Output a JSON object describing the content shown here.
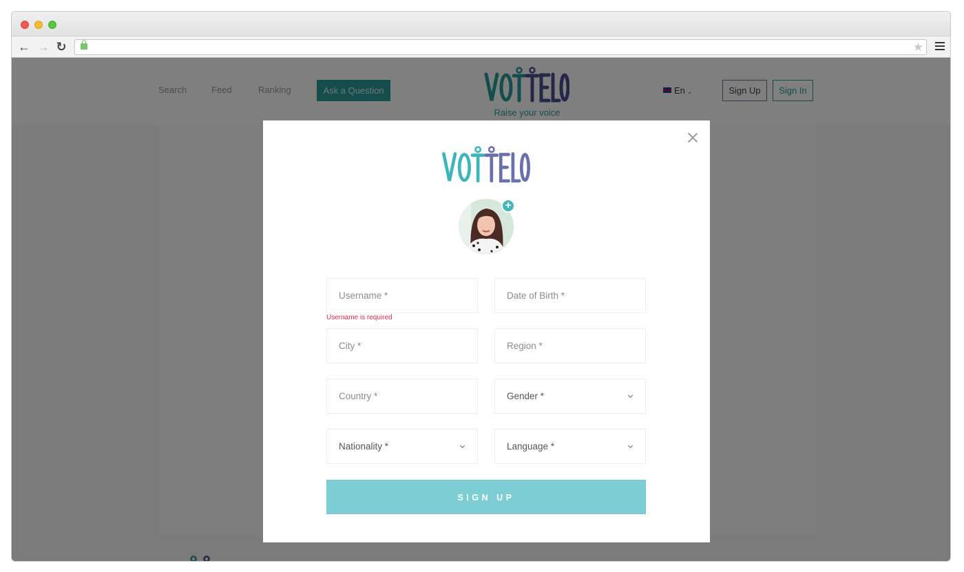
{
  "browser": {
    "url": "",
    "secure": true
  },
  "site": {
    "nav": [
      "Search",
      "Feed",
      "Ranking"
    ],
    "ask_button": "Ask a Question",
    "brand": "VOTTELO",
    "tagline": "Raise your voice",
    "language": "En",
    "sign_up": "Sign Up",
    "sign_in": "Sign In"
  },
  "modal": {
    "brand": "VOTTELO",
    "avatar_add_icon": "plus-icon",
    "fields": {
      "username": {
        "placeholder": "Username *",
        "value": ""
      },
      "date_of_birth": {
        "placeholder": "Date of Birth *",
        "value": ""
      },
      "city": {
        "placeholder": "City *",
        "value": ""
      },
      "region": {
        "placeholder": "Region *",
        "value": ""
      },
      "country": {
        "placeholder": "Country *",
        "value": ""
      },
      "gender": {
        "label": "Gender *"
      },
      "nationality": {
        "label": "Nationality *"
      },
      "language": {
        "label": "Language *"
      }
    },
    "error_username": "Username is required",
    "submit": "SIGN UP"
  },
  "colors": {
    "brand_teal": "#2a9b9a",
    "brand_purple": "#5a5f9e",
    "submit_bg": "#7dced4",
    "error": "#e5274b"
  }
}
